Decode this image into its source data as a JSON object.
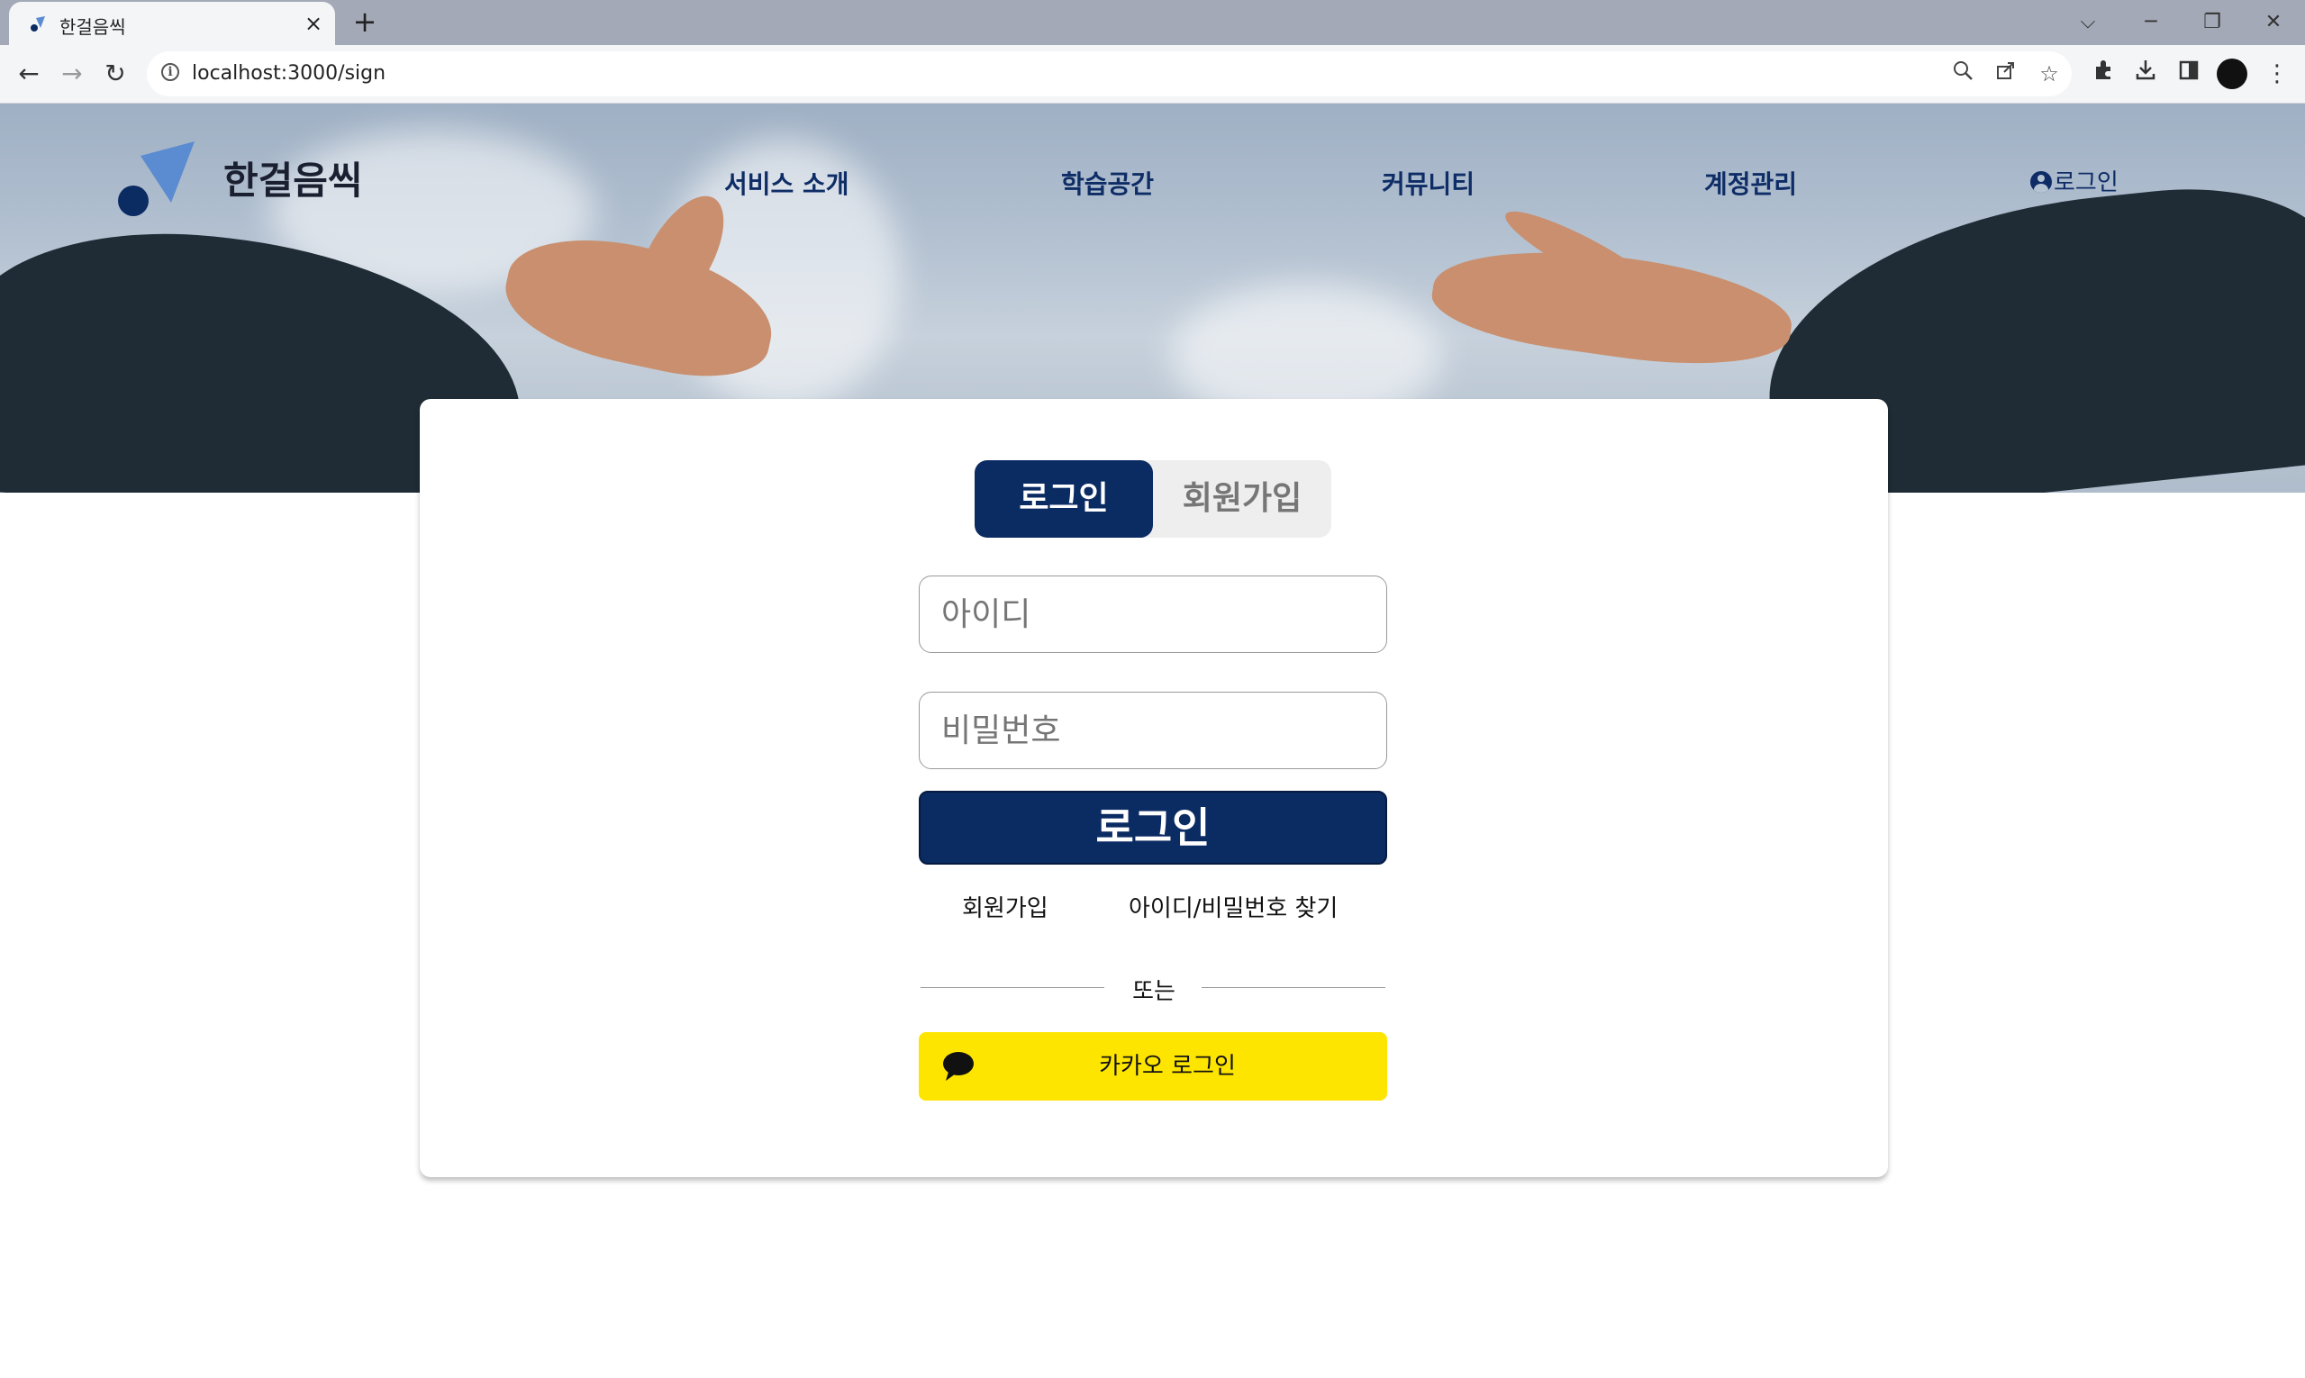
{
  "browser": {
    "tab_title": "한걸음씩",
    "tab_close": "×",
    "new_tab": "+",
    "url": "localhost:3000/sign",
    "window_controls": {
      "dropdown": "⌵",
      "minimize": "─",
      "restore": "❐",
      "close": "✕"
    },
    "nav": {
      "back": "←",
      "forward": "→",
      "reload": "↻"
    },
    "icons": [
      "zoom-icon",
      "share-icon",
      "star-icon",
      "extensions-icon",
      "download-icon",
      "sidepanel-icon",
      "profile-avatar",
      "menu-icon"
    ]
  },
  "header": {
    "logo_text": "한걸음씩",
    "nav_items": [
      "서비스 소개",
      "학습공간",
      "커뮤니티",
      "계정관리"
    ],
    "login_label": "로그인"
  },
  "auth": {
    "tabs": {
      "login": "로그인",
      "signup": "회원가입"
    },
    "active_tab": "login",
    "id_placeholder": "아이디",
    "password_placeholder": "비밀번호",
    "login_button": "로그인",
    "signup_link": "회원가입",
    "find_link": "아이디/비밀번호 찾기",
    "divider_text": "또는",
    "kakao_button": "카카오 로그인"
  },
  "colors": {
    "primary": "#0b2b63",
    "kakao": "#fee500",
    "nav_text": "#0e2d66"
  }
}
